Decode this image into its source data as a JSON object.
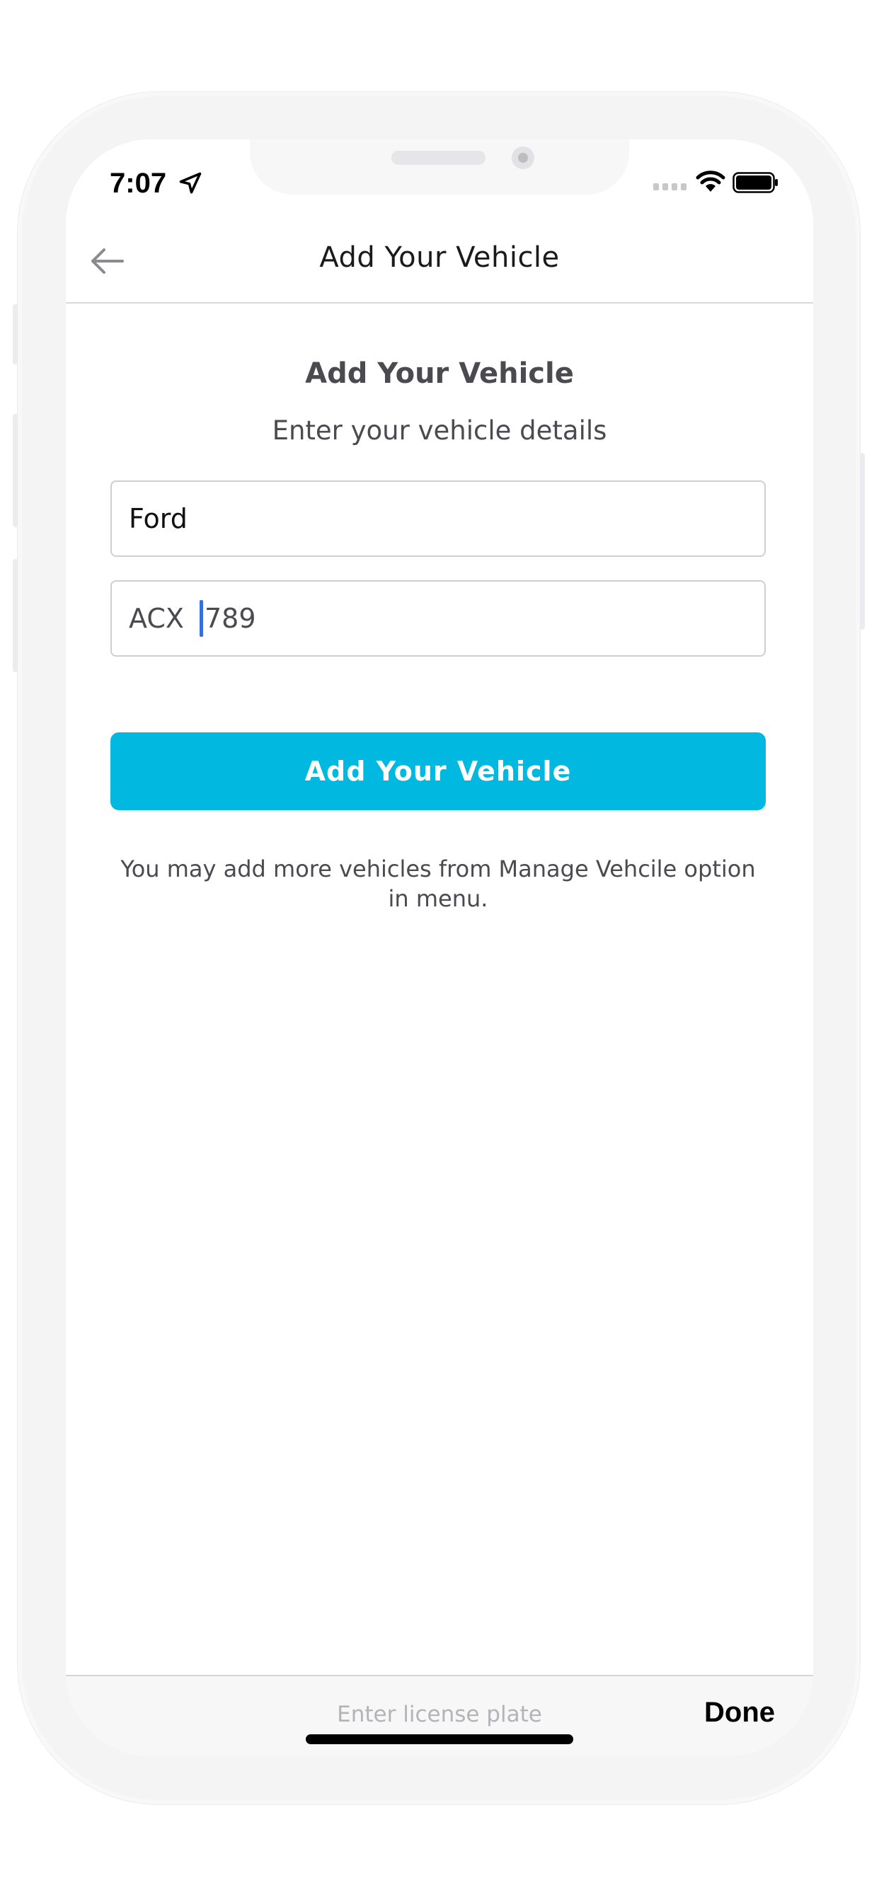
{
  "status_bar": {
    "time": "7:07",
    "icons": [
      "location-arrow-icon",
      "signal-icon",
      "wifi-icon",
      "battery-icon"
    ]
  },
  "header": {
    "back_icon": "arrow-left-icon",
    "title": "Add Your Vehicle"
  },
  "main": {
    "heading": "Add Your Vehicle",
    "subheading": "Enter your vehicle details",
    "vehicle_make_value": "Ford",
    "license_plate_before_caret": "ACX ",
    "license_plate_after_caret": "789",
    "submit_label": "Add Your Vehicle",
    "helper_text": "You may add more vehicles from Manage Vehcile option in menu."
  },
  "keyboard_accessory": {
    "placeholder": "Enter license plate",
    "done_label": "Done"
  },
  "colors": {
    "accent": "#00b8e0",
    "caret": "#3a6fd8",
    "text_muted": "#4a4a50"
  }
}
